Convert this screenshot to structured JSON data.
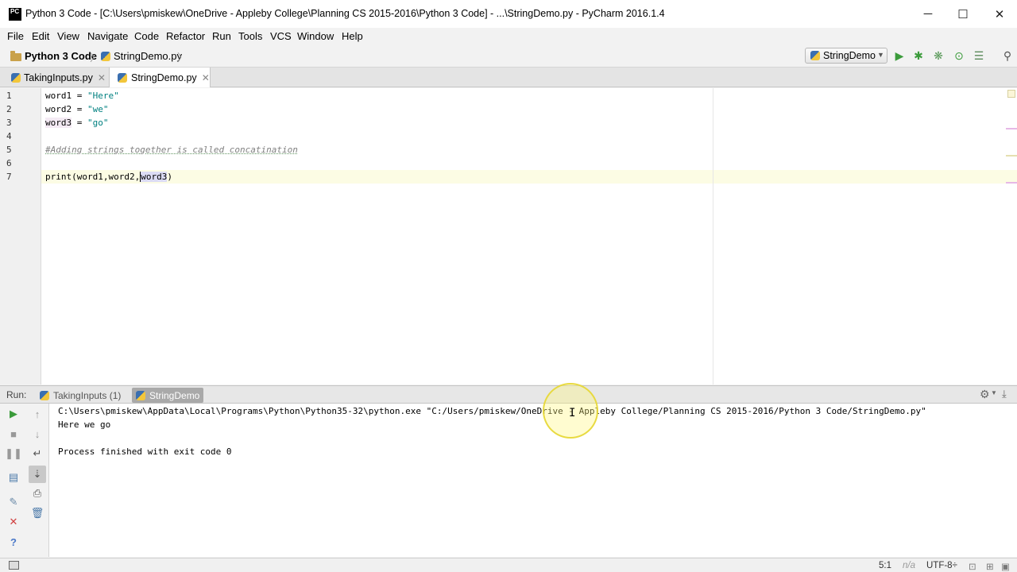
{
  "window": {
    "title": "Python 3 Code - [C:\\Users\\pmiskew\\OneDrive - Appleby College\\Planning CS 2015-2016\\Python 3 Code] - ...\\StringDemo.py - PyCharm 2016.1.4",
    "logo": "PC",
    "minimize": "─",
    "maximize": "☐",
    "close": "✕"
  },
  "menu": [
    "File",
    "Edit",
    "View",
    "Navigate",
    "Code",
    "Refactor",
    "Run",
    "Tools",
    "VCS",
    "Window",
    "Help"
  ],
  "breadcrumb": {
    "project": "Python 3 Code",
    "file": "StringDemo.py"
  },
  "toolbar": {
    "run_config": "StringDemo",
    "icons": [
      "run-icon",
      "debug-icon",
      "coverage-icon",
      "profile-icon",
      "structure-icon",
      "search-icon"
    ]
  },
  "tabs": [
    {
      "label": "TakingInputs.py",
      "active": false
    },
    {
      "label": "StringDemo.py",
      "active": true
    }
  ],
  "editor": {
    "line_numbers": [
      "1",
      "2",
      "3",
      "4",
      "5",
      "6",
      "7"
    ],
    "lines": [
      {
        "var": "word1",
        "op": " = ",
        "str": "\"Here\""
      },
      {
        "var": "word2",
        "op": " = ",
        "str": "\"we\""
      },
      {
        "var": "word3",
        "op": " = ",
        "str": "\"go\""
      },
      {
        "comment": "#Adding strings together is called concatination"
      },
      {
        "code_a": "print(word1,word2,",
        "code_sel": "word3",
        "code_b": ")"
      }
    ]
  },
  "run_panel": {
    "label": "Run:",
    "tabs": [
      {
        "label": "TakingInputs (1)",
        "active": false
      },
      {
        "label": "StringDemo",
        "active": true
      }
    ],
    "output": [
      "C:\\Users\\pmiskew\\AppData\\Local\\Programs\\Python\\Python35-32\\python.exe \"C:/Users/pmiskew/OneDrive - Appleby College/Planning CS 2015-2016/Python 3 Code/StringDemo.py\"",
      "Here we go",
      "",
      "Process finished with exit code 0"
    ]
  },
  "status": {
    "position": "5:1",
    "na": "n/a",
    "encoding": "UTF-8÷"
  },
  "colors": {
    "run_green": "#3b9b3b",
    "string_teal": "#008080",
    "comment_gray": "#808080",
    "current_line": "#fcfce4",
    "stop_red": "#d04040"
  }
}
